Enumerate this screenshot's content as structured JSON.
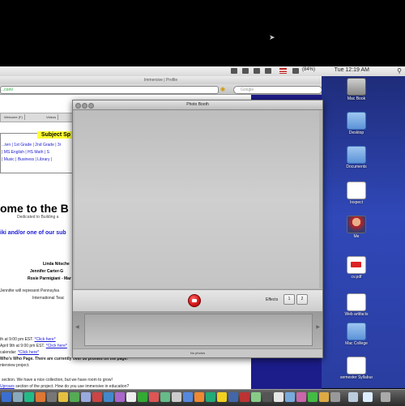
{
  "menubar": {
    "clock": "Tue 12:19 AM",
    "battery": "(84%)"
  },
  "browser": {
    "title": "Immersive | Profile",
    "url": "...com/",
    "search_placeholder": "Google",
    "nav_tabs": [
      "Welcome (F)",
      "Videos"
    ],
    "subject_title": "Subject Sp",
    "subject_rows": [
      "...ten | 1st Grade | 2nd Grade | 3r",
      "| MS English | HS Math | S",
      "| Music | Business | Library |"
    ],
    "welcome": "ome to the B",
    "dedicated": "Dedicated to Building a",
    "blue_line": "iki and/or one of our sub",
    "names": [
      "Linda Nitsche",
      "Jennifer Carter-G",
      "Rosie Parmigiani - Mar"
    ],
    "jennifer_line": "Jennifer will represent Pennsylva",
    "intl_line": "International Teac",
    "schedule_rows": [
      "th at 9:00 pm EST.",
      "April 9th at 9:00 pm EST.",
      "calendar:",
      "Who's Who Page. There are currently over 50 profiles on the page!",
      "nterview project.",
      "section. We have a nice collection, but we have room to grow!",
      "section of the project. How do you use immersive in education?"
    ],
    "links": [
      "*Click here*",
      "*Click here*",
      "*Click here*",
      "Click here",
      "*Click here*"
    ],
    "bottom_link_a": "Collection",
    "bottom_link_b": "Uproars"
  },
  "photobooth": {
    "title": "Photo Booth",
    "effects_label": "Effects",
    "effects_buttons": [
      "1",
      "2"
    ],
    "status": "No photos"
  },
  "desktop_icons": [
    {
      "label": "Mac Book",
      "icon": "hard-drive-icon"
    },
    {
      "label": "Desktop",
      "icon": "folder-icon"
    },
    {
      "label": "Documents",
      "icon": "folder-icon"
    },
    {
      "label": "Inspect",
      "icon": "document-icon"
    },
    {
      "label": "Me",
      "icon": "person-icon"
    },
    {
      "label": "cv.pdf",
      "icon": "pdf-icon"
    },
    {
      "label": "Web artifacts",
      "icon": "document-icon"
    },
    {
      "label": "Mac College",
      "icon": "folder-icon"
    },
    {
      "label": "semester Syllabus 2009.doc",
      "icon": "document-icon"
    }
  ],
  "colors": {
    "shutter": "#d01414",
    "desktop": "#3048b8",
    "subject_highlight": "#ffff33",
    "link": "#1a1ad6"
  }
}
